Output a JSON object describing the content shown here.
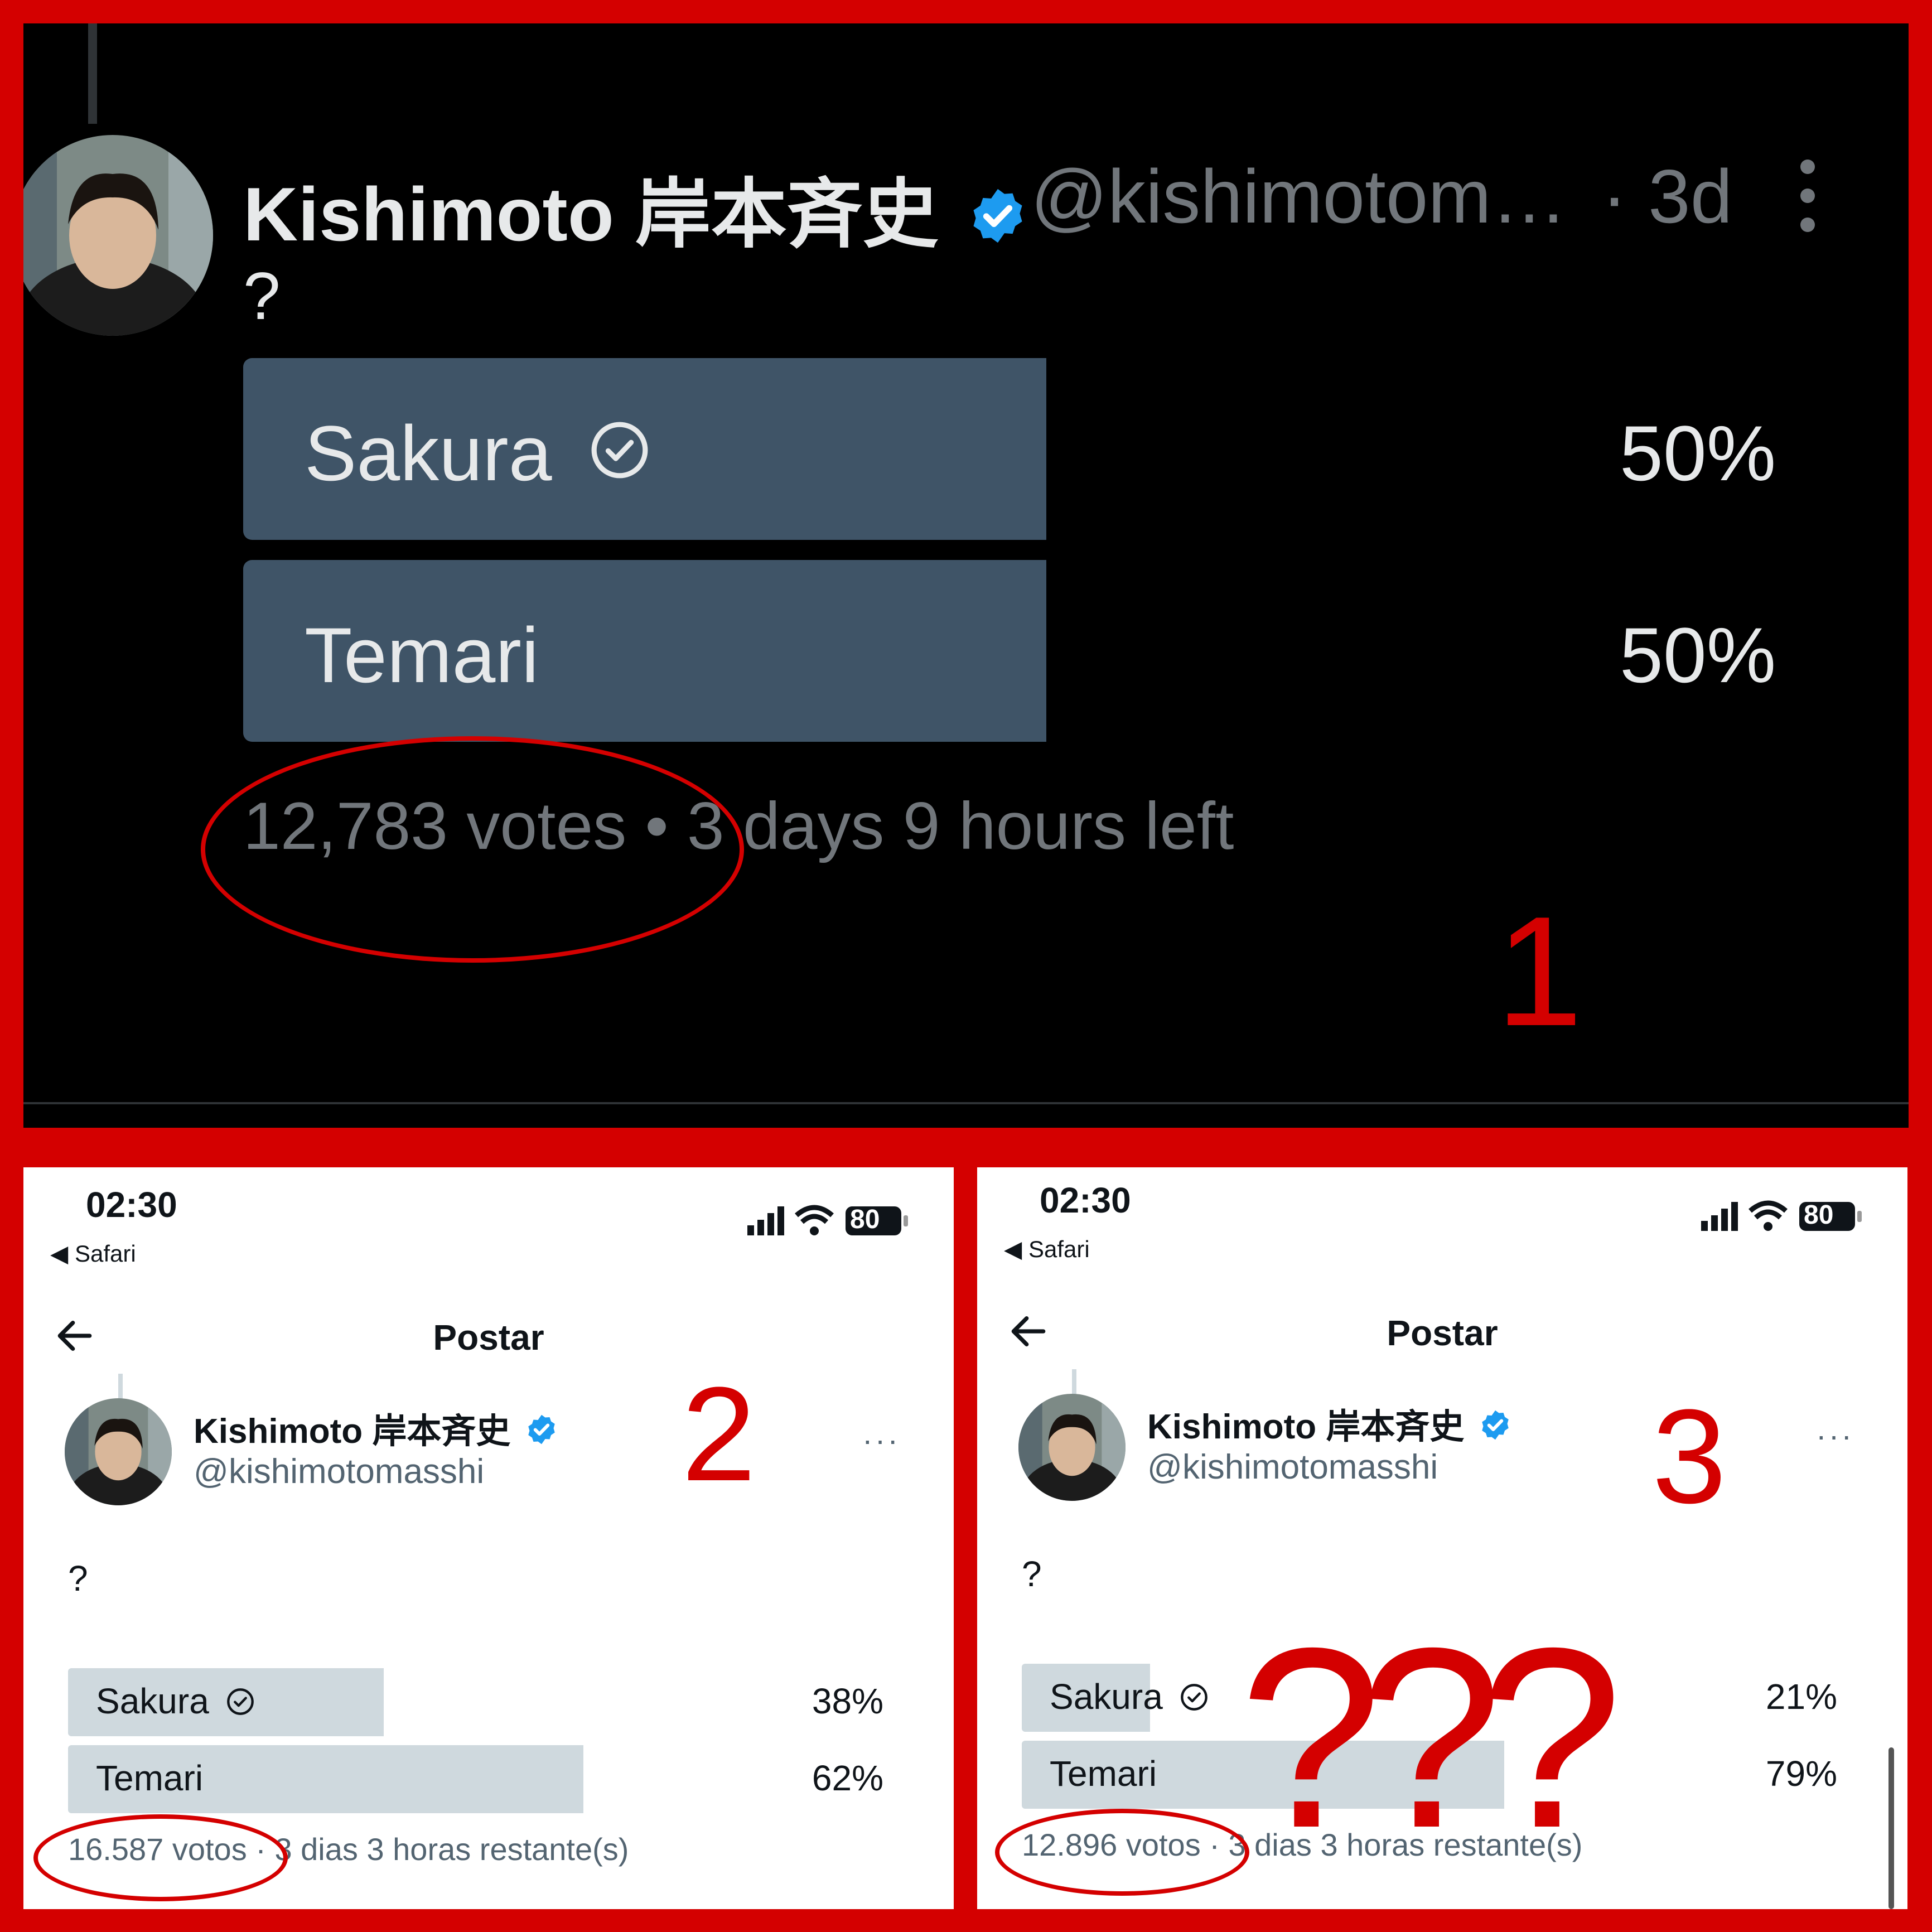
{
  "panel1": {
    "display_name": "Kishimoto 岸本斉史",
    "handle": "@kishimotom…",
    "time": "· 3d",
    "tweet_text": "?",
    "poll": {
      "options": [
        {
          "label": "Sakura",
          "pct": "50%",
          "selected": true
        },
        {
          "label": "Temari",
          "pct": "50%",
          "selected": false
        }
      ],
      "footer": "12,783 votes • 3 days 9 hours left"
    },
    "annotation_number": "1"
  },
  "panel2": {
    "status_time": "02:30",
    "back_app": "◀ Safari",
    "battery": "80",
    "page_title": "Postar",
    "display_name": "Kishimoto 岸本斉史",
    "handle": "@kishimotomasshi",
    "more": "···",
    "tweet_text": "?",
    "poll": {
      "options": [
        {
          "label": "Sakura",
          "pct": "38%",
          "fill": 0.38,
          "selected": true
        },
        {
          "label": "Temari",
          "pct": "62%",
          "fill": 0.62,
          "selected": false
        }
      ],
      "footer": "16.587 votos · 3 dias 3 horas restante(s)"
    },
    "annotation_number": "2"
  },
  "panel3": {
    "status_time": "02:30",
    "back_app": "◀ Safari",
    "battery": "80",
    "page_title": "Postar",
    "display_name": "Kishimoto 岸本斉史",
    "handle": "@kishimotomasshi",
    "more": "···",
    "tweet_text": "?",
    "poll": {
      "options": [
        {
          "label": "Sakura",
          "pct": "21%",
          "fill": 0.21,
          "selected": true
        },
        {
          "label": "Temari",
          "pct": "79%",
          "fill": 0.79,
          "selected": false
        }
      ],
      "footer": "12.896 votos · 3 dias 3 horas restante(s)"
    },
    "annotation_number": "3",
    "annotation_marks": "???"
  },
  "colors": {
    "frame_red": "#d40000",
    "verified_blue": "#1d9bf0",
    "poll_bar_dark": "#3f5467",
    "poll_bar_light": "#cfd9de"
  }
}
